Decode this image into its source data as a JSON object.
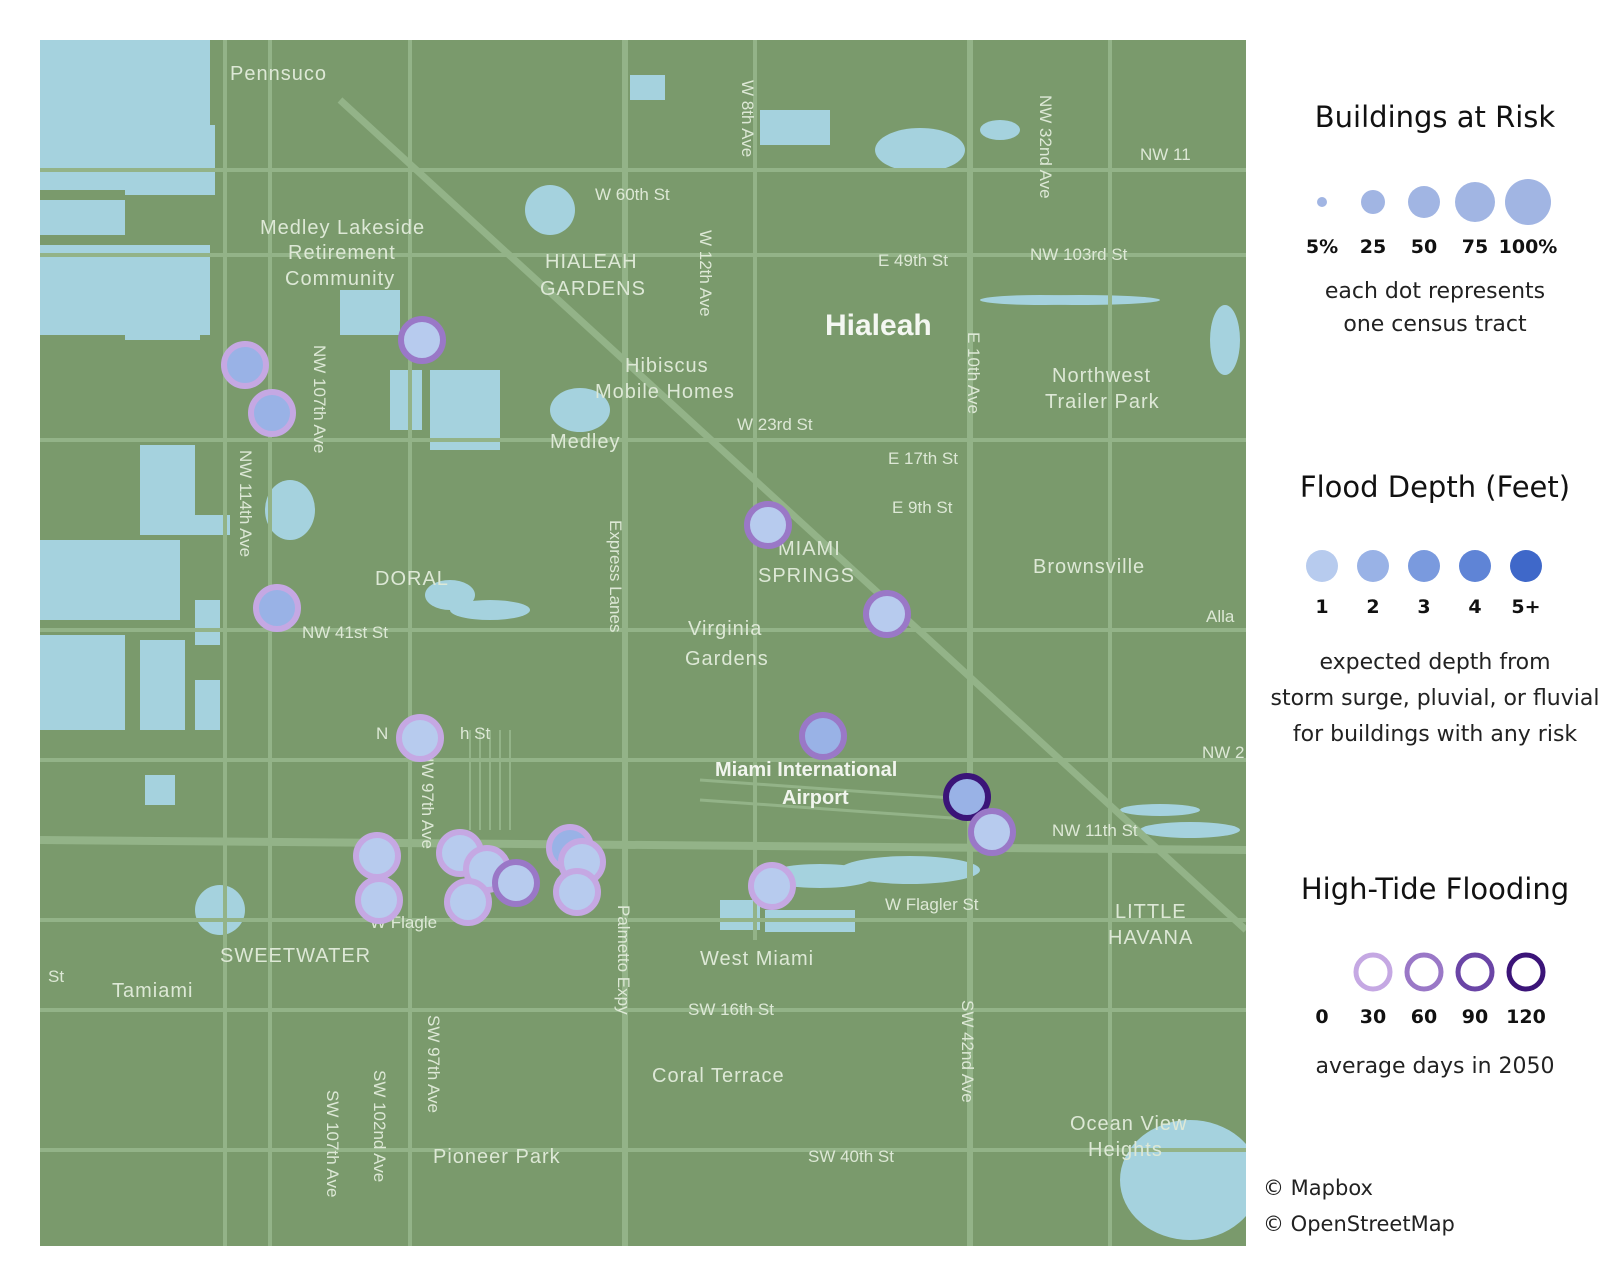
{
  "map": {
    "base_color": "#7a9a6c",
    "water_color": "#a5d2de",
    "road_color": "#93b388",
    "place_labels": [
      "Pennsuco",
      "Medley Lakeside",
      "Retirement",
      "Community",
      "HIALEAH",
      "GARDENS",
      "Hibiscus",
      "Mobile Homes",
      "Medley",
      "Hialeah",
      "DORAL",
      "MIAMI",
      "SPRINGS",
      "Virginia",
      "Gardens",
      "Brownsville",
      "Northwest",
      "Trailer Park",
      "SWEETWATER",
      "Tamiami",
      "West Miami",
      "Coral Terrace",
      "Pioneer Park",
      "LITTLE",
      "HAVANA",
      "Ocean View",
      "Heights",
      "Miami International",
      "Airport"
    ],
    "road_labels": [
      "W 8th Ave",
      "W 60th St",
      "W 12th Ave",
      "E 49th St",
      "NW 103rd St",
      "NW 32nd Ave",
      "NW 11",
      "W 23rd St",
      "E 17th St",
      "E 9th St",
      "E 10th Ave",
      "NW 107th Ave",
      "NW 114th Ave",
      "NW 41st St",
      "Express Lanes",
      "NW 97th Ave",
      "N",
      "h St",
      "NW 11th St",
      "W Flagler St",
      "W Flagle",
      "SW 16th St",
      "Palmetto Expy",
      "SW 97th Ave",
      "SW 102nd Ave",
      "SW 107th Ave",
      "SW 42nd Ave",
      "SW 40th St",
      "St",
      "NW 2",
      "Alla"
    ]
  },
  "tracts": [
    {
      "risk": 25,
      "depth": 2,
      "tide": 30
    },
    {
      "risk": 25,
      "depth": 2,
      "tide": 30
    },
    {
      "risk": 25,
      "depth": 1,
      "tide": 60
    },
    {
      "risk": 25,
      "depth": 2,
      "tide": 30
    },
    {
      "risk": 25,
      "depth": 1,
      "tide": 60
    },
    {
      "risk": 25,
      "depth": 1,
      "tide": 60
    },
    {
      "risk": 25,
      "depth": 1,
      "tide": 30
    },
    {
      "risk": 25,
      "depth": 2,
      "tide": 60
    },
    {
      "risk": 25,
      "depth": 1,
      "tide": 30
    },
    {
      "risk": 25,
      "depth": 1,
      "tide": 30
    },
    {
      "risk": 25,
      "depth": 1,
      "tide": 30
    },
    {
      "risk": 25,
      "depth": 1,
      "tide": 30
    },
    {
      "risk": 25,
      "depth": 1,
      "tide": 60
    },
    {
      "risk": 25,
      "depth": 1,
      "tide": 30
    },
    {
      "risk": 25,
      "depth": 2,
      "tide": 30
    },
    {
      "risk": 25,
      "depth": 1,
      "tide": 30
    },
    {
      "risk": 25,
      "depth": 1,
      "tide": 30
    },
    {
      "risk": 25,
      "depth": 1,
      "tide": 30
    },
    {
      "risk": 25,
      "depth": 2,
      "tide": 120
    },
    {
      "risk": 25,
      "depth": 1,
      "tide": 60
    }
  ],
  "legend": {
    "risk": {
      "title": "Buildings at Risk",
      "labels": [
        "5%",
        "25",
        "50",
        "75",
        "100%"
      ],
      "color": "#a1b5e3",
      "note1": "each dot represents",
      "note2": "one census tract"
    },
    "depth": {
      "title": "Flood Depth (Feet)",
      "labels": [
        "1",
        "2",
        "3",
        "4",
        "5+"
      ],
      "colors": [
        "#b7cbee",
        "#99b2e6",
        "#7a9ade",
        "#5f84d6",
        "#3f68c9"
      ],
      "note1": "expected depth from",
      "note2": "storm surge, pluvial, or fluvial",
      "note3": "for buildings with any risk"
    },
    "tide": {
      "title": "High-Tide Flooding",
      "labels": [
        "0",
        "30",
        "60",
        "90",
        "120"
      ],
      "colors": [
        "#ffffff",
        "#c5a8e3",
        "#9a78c7",
        "#6a45a6",
        "#3b1478"
      ],
      "note": "average days in 2050"
    }
  },
  "credits": [
    "© Mapbox",
    "© OpenStreetMap"
  ]
}
